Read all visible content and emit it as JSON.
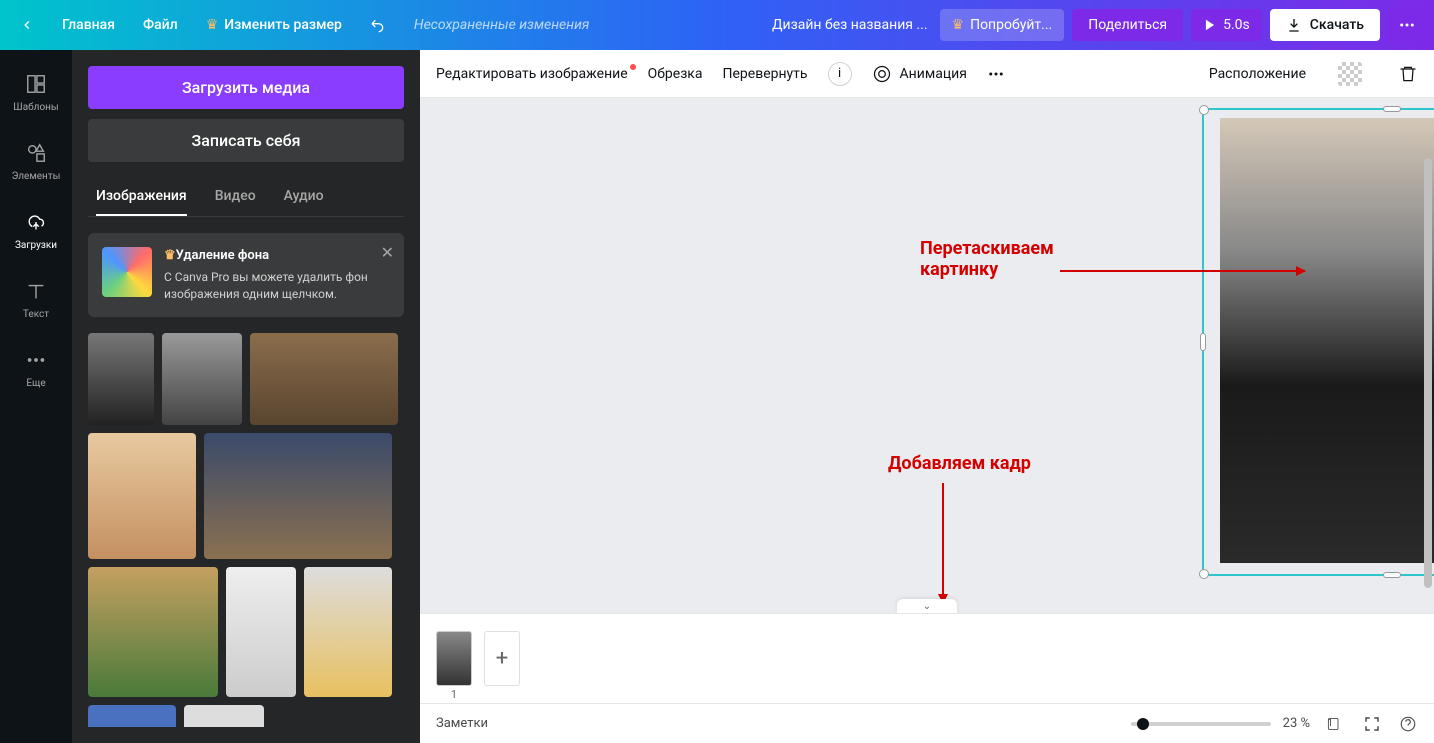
{
  "topbar": {
    "home": "Главная",
    "file": "Файл",
    "resize": "Изменить размер",
    "unsaved": "Несохраненные изменения",
    "doc_name": "Дизайн без названия ...",
    "try_pro": "Попробуйт...",
    "share": "Поделиться",
    "duration": "5.0s",
    "download": "Скачать"
  },
  "sidebar": {
    "templates": "Шаблоны",
    "elements": "Элементы",
    "uploads": "Загрузки",
    "text": "Текст",
    "more": "Еще"
  },
  "panel": {
    "upload_media": "Загрузить медиа",
    "record_self": "Записать себя",
    "tab_images": "Изображения",
    "tab_video": "Видео",
    "tab_audio": "Аудио",
    "promo_title": "Удаление фона",
    "promo_body": "С Canva Pro вы можете удалить фон изображения одним щелчком."
  },
  "toolbar": {
    "edit_image": "Редактировать изображение",
    "crop": "Обрезка",
    "flip": "Перевернуть",
    "animation": "Анимация",
    "position": "Расположение"
  },
  "annotations": {
    "drag_image_l1": "Перетаскиваем",
    "drag_image_l2": "картинку",
    "add_frame": "Добавляем кадр"
  },
  "timeline": {
    "page_num": "1"
  },
  "bottom": {
    "notes": "Заметки",
    "zoom": "23 %",
    "page_indicator": "1"
  }
}
